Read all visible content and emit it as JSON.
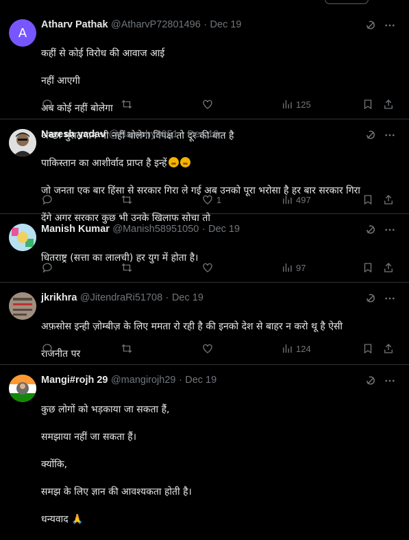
{
  "tweets": [
    {
      "name": "Atharv Pathak",
      "handle": "@AtharvP72801496",
      "date": "Dec 19",
      "avatar_letter": "A",
      "avatar_color": "#7856ff",
      "lines": [
        "कहीं से कोई विरोध की आवाज आई",
        "नहीं आएगी",
        "अब कोई नहीं बोलेगा",
        "अच्छा मुसलमान भी नहीं बोलेगा विपक्ष तो दूर की बात है"
      ],
      "likes": "",
      "views": "125"
    },
    {
      "name": "Naresh yadav",
      "handle": "@Nareshy8251",
      "date": "Dec 19",
      "avatar_color": "#c9c9c9",
      "lines": [
        "पाकिस्तान का आशीर्वाद प्राप्त है इन्हें",
        "जो जनता एक बार हिंसा से सरकार गिरा ले गई अब उनको पूरा भरोसा है हर बार सरकार गिरा",
        "देंगे अगर सरकार कुछ भी उनके खिलाफ सोचा तो"
      ],
      "likes": "1",
      "views": "497"
    },
    {
      "name": "Manish Kumar",
      "handle": "@Manish58951050",
      "date": "Dec 19",
      "avatar_color": "#5fb3d9",
      "lines": [
        "धितराष्ट्र (सत्ता का लालची) हर युग में होता है।"
      ],
      "likes": "",
      "views": "97"
    },
    {
      "name": "jkrikhra",
      "handle": "@JitendraRi51708",
      "date": "Dec 19",
      "avatar_color": "#8a8a8a",
      "lines": [
        "अफ़सोस इन्ही ज़ोम्बीज़ के लिए ममता रो रही है की इनको देश से बाहर न करो थू है ऐसी",
        "राजनीत पर"
      ],
      "likes": "",
      "views": "124"
    },
    {
      "name": "Mangi#rojh 29",
      "handle": "@mangirojh29",
      "date": "Dec 19",
      "avatar_color": "#ff9933",
      "lines": [
        "कुछ लोगों को भड़काया जा सकता हैं,",
        "समझाया नहीं जा सकता हैं।",
        "क्योंकि,",
        "समझ के लिए ज्ञान की आवश्यकता होती है।",
        "धन्यवाद 🙏"
      ]
    }
  ],
  "icons": [
    "reply-icon",
    "retweet-icon",
    "like-icon",
    "views-icon",
    "bookmark-icon",
    "share-icon",
    "grok-icon",
    "more-icon"
  ]
}
